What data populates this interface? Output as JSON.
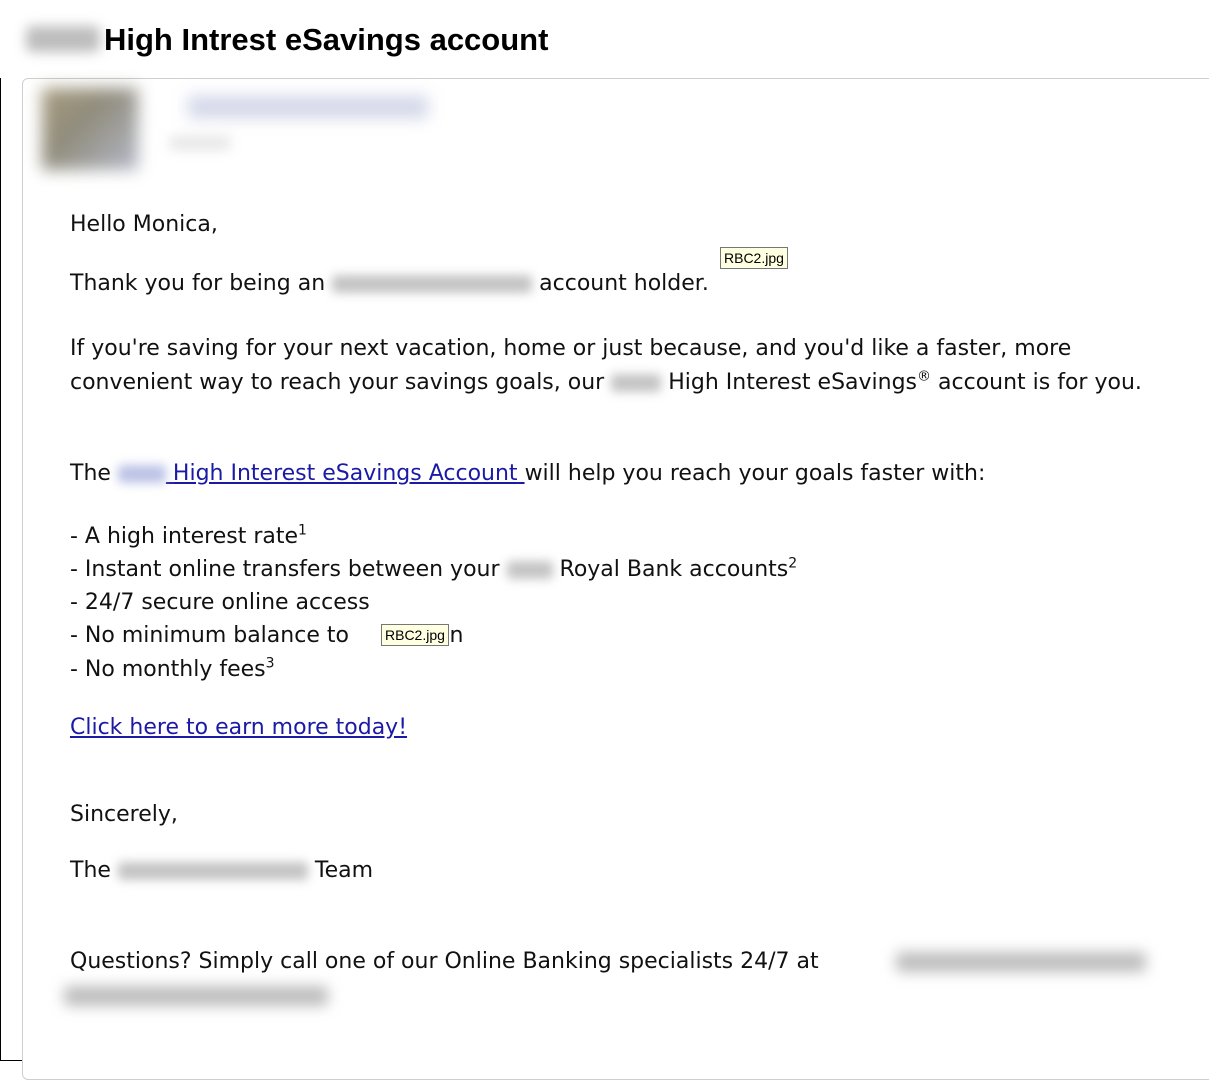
{
  "window": {
    "title": "High Intrest eSavings account"
  },
  "email": {
    "greeting": "Hello Monica,",
    "thank_prefix": "Thank you for being an",
    "thank_suffix": "account holder.",
    "intro_part1": "If you're saving for your next vacation, home or just because, and you'd like a faster, more convenient way to reach your savings goals, our",
    "intro_part2": "High Interest eSavings",
    "intro_reg": "®",
    "intro_part3": "account is for you.",
    "link_line_prefix": "The",
    "link_text": "High Interest eSavings Account",
    "link_line_suffix": "will help you reach your goals faster with:",
    "benefits": [
      {
        "text": "- A high interest rate",
        "sup": "1"
      },
      {
        "text_a": "- Instant online transfers between your",
        "text_b": "Royal Bank accounts",
        "sup": "2"
      },
      {
        "text": "- 24/7 secure online access"
      },
      {
        "text_a": "- No minimum balance to ",
        "text_b": "ain"
      },
      {
        "text": "- No monthly fees",
        "sup": "3"
      }
    ],
    "cta_link": "Click here to earn more today!",
    "closing": "Sincerely,",
    "signature_prefix": "The",
    "signature_suffix": "Team",
    "questions": "Questions? Simply call one of our Online Banking specialists 24/7 at"
  },
  "tooltips": {
    "tooltip_1": "RBC2.jpg",
    "tooltip_2": "RBC2.jpg"
  }
}
